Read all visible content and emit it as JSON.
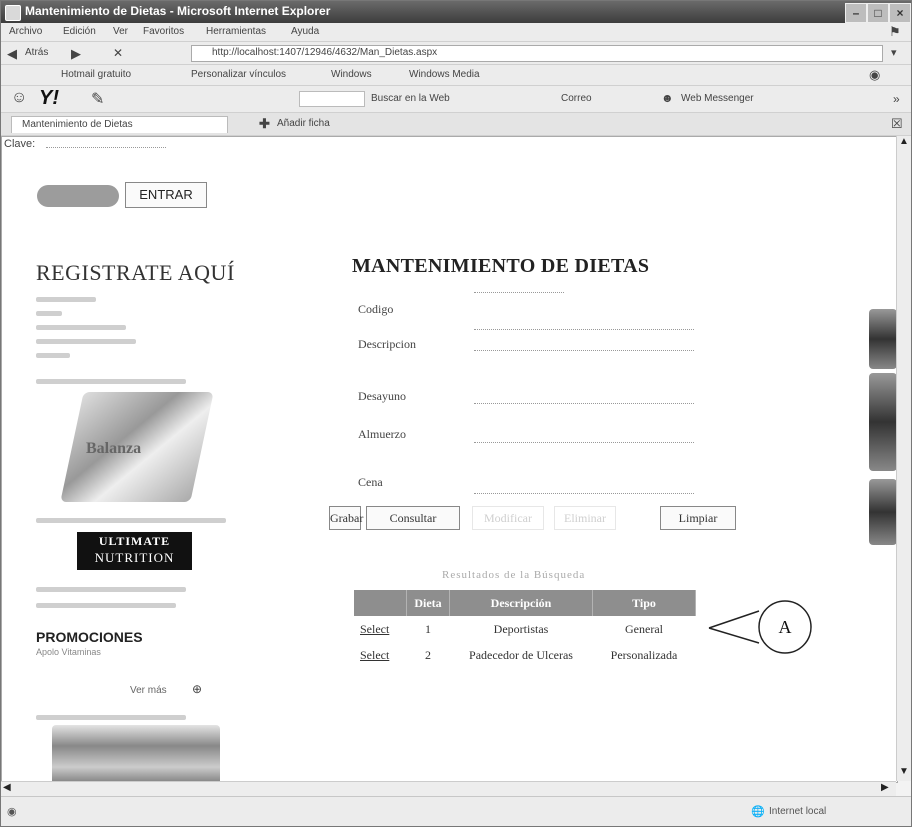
{
  "window": {
    "title": "Mantenimiento de Dietas - Microsoft Internet Explorer",
    "min": "–",
    "max": "□",
    "close": "×"
  },
  "menubar": {
    "items": [
      "Archivo",
      "Edición",
      "Ver",
      "Favoritos",
      "Herramientas",
      "Ayuda"
    ]
  },
  "navbar": {
    "back_label": "Atrás",
    "address": "http://localhost:1407/12946/4632/Man_Dietas.aspx"
  },
  "linksbar": {
    "items": [
      "Hotmail gratuito",
      "Personalizar vínculos",
      "Windows",
      "Windows Media"
    ]
  },
  "yahoobar": {
    "logo": "Y!",
    "search": "Buscar en la Web",
    "correo": "Correo",
    "messenger": "Web Messenger"
  },
  "tabs": {
    "tab_title": "Mantenimiento de Dietas",
    "add_label": "Añadir ficha"
  },
  "left": {
    "clave_label": "Clave:",
    "entrar_label": "ENTRAR",
    "registrate": "REGISTRATE AQUÍ",
    "scale_text": "Balanza",
    "ultimate_line1": "ULTIMATE",
    "ultimate_line2": "NUTRITION",
    "promo": "PROMOCIONES",
    "promo_sub": "Apolo Vitaminas",
    "ver_label": "Ver más"
  },
  "main": {
    "title": "MANTENIMIENTO DE DIETAS",
    "labels": {
      "codigo": "Codigo",
      "descripcion": "Descripcion",
      "desayuno": "Desayuno",
      "almuerzo": "Almuerzo",
      "cena": "Cena"
    },
    "buttons": {
      "grabar": "Grabar",
      "consultar": "Consultar",
      "modificar": "Modificar",
      "eliminar": "Eliminar",
      "limpiar": "Limpiar"
    },
    "grid_caption": "Resultados de la Búsqueda",
    "grid": {
      "headers": [
        "",
        "Dieta",
        "Descripción",
        "Tipo"
      ],
      "rows": [
        {
          "select": "Select",
          "dieta": "1",
          "descripcion": "Deportistas",
          "tipo": "General"
        },
        {
          "select": "Select",
          "dieta": "2",
          "descripcion": "Padecedor de Ulceras",
          "tipo": "Personalizada"
        }
      ]
    }
  },
  "callout": {
    "label": "A"
  },
  "status": {
    "zone": "Internet local"
  }
}
